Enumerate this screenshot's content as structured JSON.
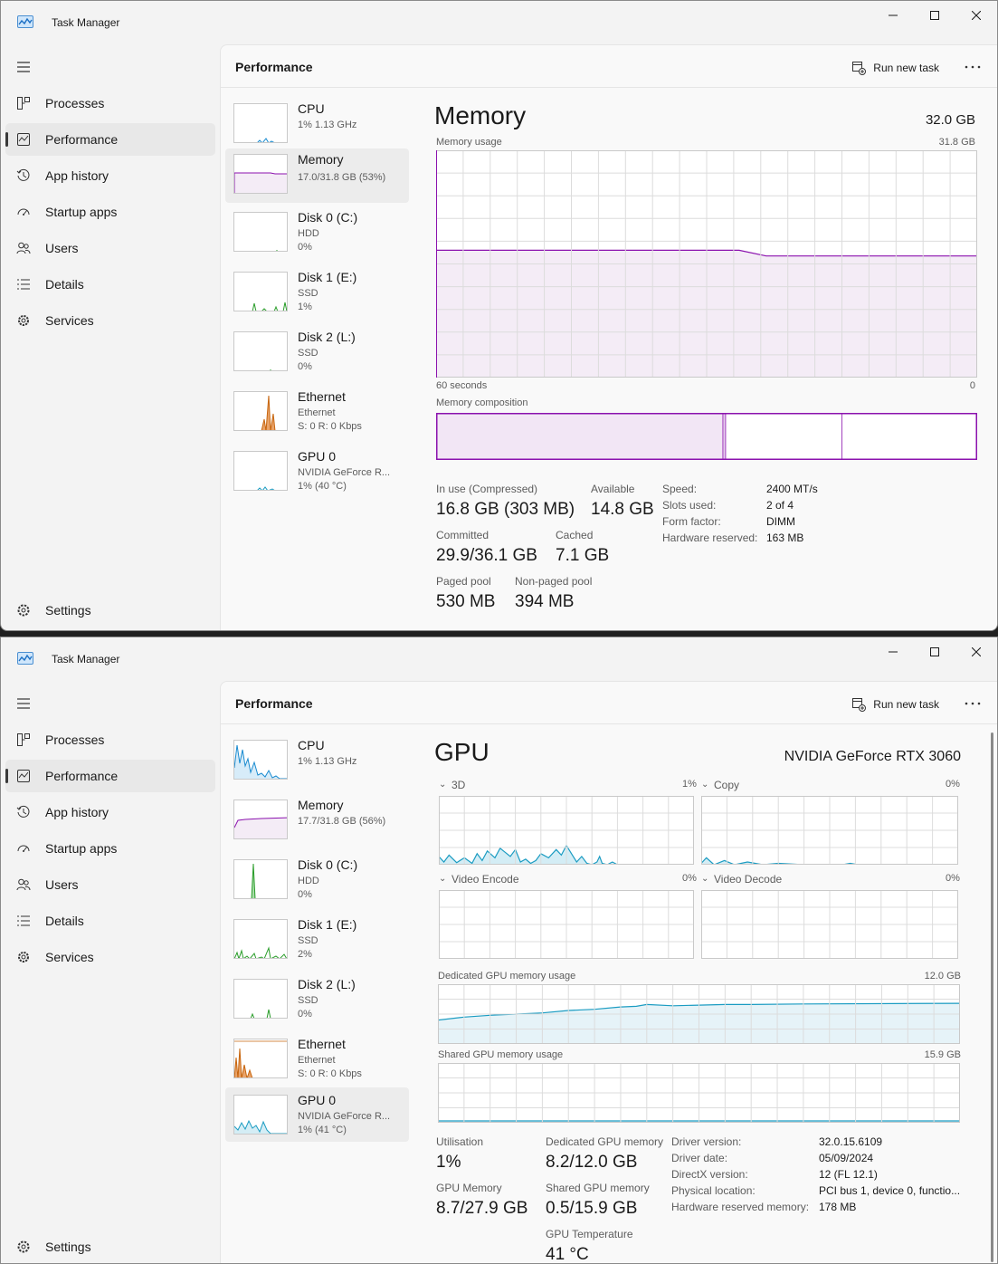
{
  "app": {
    "title": "Task Manager"
  },
  "nav": {
    "items": [
      {
        "label": "Processes",
        "icon": "processes-icon"
      },
      {
        "label": "Performance",
        "icon": "performance-icon"
      },
      {
        "label": "App history",
        "icon": "app-history-icon"
      },
      {
        "label": "Startup apps",
        "icon": "startup-apps-icon"
      },
      {
        "label": "Users",
        "icon": "users-icon"
      },
      {
        "label": "Details",
        "icon": "details-icon"
      },
      {
        "label": "Services",
        "icon": "services-icon"
      }
    ],
    "settings_label": "Settings"
  },
  "header": {
    "title": "Performance",
    "run_new_task": "Run new task"
  },
  "window1": {
    "resources": [
      {
        "name": "CPU",
        "sub1": "1%  1.13 GHz",
        "sub2": ""
      },
      {
        "name": "Memory",
        "sub1": "17.0/31.8 GB (53%)",
        "sub2": ""
      },
      {
        "name": "Disk 0 (C:)",
        "sub1": "HDD",
        "sub2": "0%"
      },
      {
        "name": "Disk 1 (E:)",
        "sub1": "SSD",
        "sub2": "1%"
      },
      {
        "name": "Disk 2 (L:)",
        "sub1": "SSD",
        "sub2": "0%"
      },
      {
        "name": "Ethernet",
        "sub1": "Ethernet",
        "sub2": "S: 0 R: 0 Kbps"
      },
      {
        "name": "GPU 0",
        "sub1": "NVIDIA GeForce R...",
        "sub2": "1%  (40 °C)"
      }
    ],
    "memory": {
      "title": "Memory",
      "total": "32.0 GB",
      "usage_label": "Memory usage",
      "usage_max": "31.8 GB",
      "time_left": "60 seconds",
      "time_right": "0",
      "composition_label": "Memory composition",
      "usage_before": 0.56,
      "usage_after": 0.535,
      "composition": {
        "in_use": 0.53,
        "modified": 0.005,
        "standby": 0.215,
        "free": 0.25
      },
      "stats": {
        "in_use_label": "In use (Compressed)",
        "in_use_value": "16.8 GB (303 MB)",
        "available_label": "Available",
        "available_value": "14.8 GB",
        "committed_label": "Committed",
        "committed_value": "29.9/36.1 GB",
        "cached_label": "Cached",
        "cached_value": "7.1 GB",
        "paged_label": "Paged pool",
        "paged_value": "530 MB",
        "nonpaged_label": "Non-paged pool",
        "nonpaged_value": "394 MB"
      },
      "specs": [
        {
          "key": "Speed:",
          "value": "2400 MT/s"
        },
        {
          "key": "Slots used:",
          "value": "2 of 4"
        },
        {
          "key": "Form factor:",
          "value": "DIMM"
        },
        {
          "key": "Hardware reserved:",
          "value": "163 MB"
        }
      ]
    }
  },
  "window2": {
    "resources": [
      {
        "name": "CPU",
        "sub1": "1%  1.13 GHz",
        "sub2": ""
      },
      {
        "name": "Memory",
        "sub1": "17.7/31.8 GB (56%)",
        "sub2": ""
      },
      {
        "name": "Disk 0 (C:)",
        "sub1": "HDD",
        "sub2": "0%"
      },
      {
        "name": "Disk 1 (E:)",
        "sub1": "SSD",
        "sub2": "2%"
      },
      {
        "name": "Disk 2 (L:)",
        "sub1": "SSD",
        "sub2": "0%"
      },
      {
        "name": "Ethernet",
        "sub1": "Ethernet",
        "sub2": "S: 0 R: 0 Kbps"
      },
      {
        "name": "GPU 0",
        "sub1": "NVIDIA GeForce R...",
        "sub2": "1%  (41 °C)"
      }
    ],
    "gpu": {
      "title": "GPU",
      "model": "NVIDIA GeForce RTX 3060",
      "engines": [
        {
          "name": "3D",
          "percent": "1%"
        },
        {
          "name": "Copy",
          "percent": "0%"
        },
        {
          "name": "Video Encode",
          "percent": "0%"
        },
        {
          "name": "Video Decode",
          "percent": "0%"
        }
      ],
      "dedicated_label": "Dedicated GPU memory usage",
      "dedicated_max": "12.0 GB",
      "shared_label": "Shared GPU memory usage",
      "shared_max": "15.9 GB",
      "stats": {
        "util_label": "Utilisation",
        "util_value": "1%",
        "ded_label": "Dedicated GPU memory",
        "ded_value": "8.2/12.0 GB",
        "gpumem_label": "GPU Memory",
        "gpumem_value": "8.7/27.9 GB",
        "shared_label": "Shared GPU memory",
        "shared_value": "0.5/15.9 GB",
        "temp_label": "GPU Temperature",
        "temp_value": "41 °C"
      },
      "specs": [
        {
          "key": "Driver version:",
          "value": "32.0.15.6109"
        },
        {
          "key": "Driver date:",
          "value": "05/09/2024"
        },
        {
          "key": "DirectX version:",
          "value": "12 (FL 12.1)"
        },
        {
          "key": "Physical location:",
          "value": "PCI bus 1, device 0, functio..."
        },
        {
          "key": "Hardware reserved memory:",
          "value": "178 MB"
        }
      ]
    }
  },
  "colors": {
    "memory": "#8b12ae",
    "memory_fill": "#f4ecf6",
    "cpu": "#1a8bd0",
    "disk": "#2a9d2a",
    "ethernet": "#c7650e",
    "gpu": "#1b9cc2",
    "grid": "#dcdcdc"
  }
}
